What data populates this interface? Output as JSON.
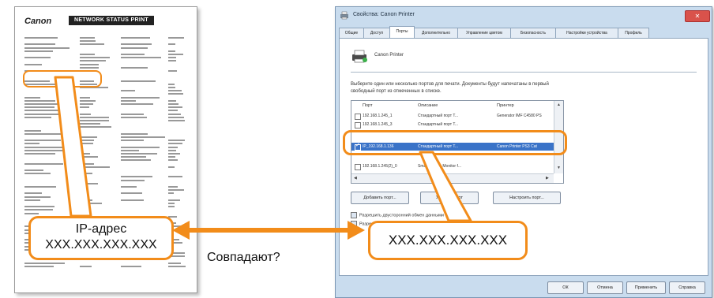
{
  "status_page": {
    "logo": "Canon",
    "title": "NETWORK STATUS PRINT",
    "title_suffix": "",
    "footer": ""
  },
  "left_callout": {
    "label": "IP-адрес",
    "value": "XXX.XXX.XXX.XXX"
  },
  "match_question": "Совпадают?",
  "right_callout": {
    "value": "XXX.XXX.XXX.XXX"
  },
  "dialog": {
    "title": "Свойства: Canon Printer",
    "close_label": "✕",
    "tabs": [
      {
        "label": "Общие",
        "active": false
      },
      {
        "label": "Доступ",
        "active": false
      },
      {
        "label": "Порты",
        "active": true
      },
      {
        "label": "Дополнительно",
        "active": false
      },
      {
        "label": "Управление цветом",
        "active": false
      },
      {
        "label": "Безопасность",
        "active": false
      },
      {
        "label": "Настройки устройства",
        "active": false
      },
      {
        "label": "Профиль",
        "active": false
      }
    ],
    "printer_name": "Canon Printer",
    "instructions": "Выберите один или несколько портов для печати. Документы будут напечатаны в первый свободный порт из отмеченных в списке.",
    "table": {
      "headers": [
        "Порт",
        "Описание",
        "Принтер"
      ],
      "rows": [
        {
          "port": "192.168.1.245_1",
          "description": "Стандартный порт T...",
          "printer": "Generator IMF C4580 PS",
          "checked": false,
          "selected": false
        },
        {
          "port": "192.168.1.245_3",
          "description": "Стандартный порт T...",
          "printer": "",
          "checked": false,
          "selected": false
        },
        {
          "port": "IP_192.168.1.136",
          "description": "Стандартный порт T...",
          "printer": "Canon Printer PS3 Cat",
          "checked": true,
          "selected": true
        },
        {
          "port": "192.168.1.245(2)_0",
          "description": "Smart Device Monitor f...",
          "printer": "",
          "checked": false,
          "selected": false
        }
      ]
    },
    "buttons": {
      "add_port": "Добавить порт...",
      "delete_port": "Удалить порт",
      "configure_port": "Настроить порт..."
    },
    "checkboxes": {
      "bidirectional": "Разрешить двусторонний обмен данными",
      "pooling": "Разрешить группу принтеров в пул"
    },
    "bottom_buttons": {
      "ok": "ОК",
      "cancel": "Отмена",
      "apply": "Применить",
      "help": "Справка"
    }
  },
  "colors": {
    "accent": "#f28c1a",
    "selection": "#3a73c8"
  }
}
